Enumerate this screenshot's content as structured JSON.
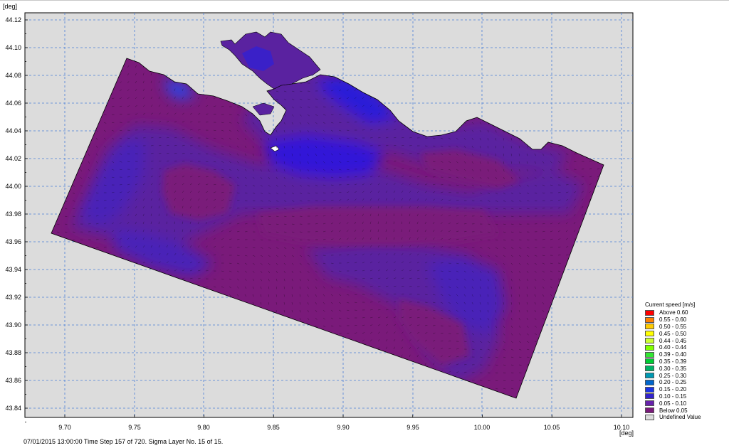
{
  "map": {
    "y_unit_label": "[deg]",
    "x_unit_label": "[deg]",
    "y_ticks": [
      "44.12",
      "44.10",
      "44.08",
      "44.06",
      "44.04",
      "44.02",
      "44.00",
      "43.98",
      "43.96",
      "43.94",
      "43.92",
      "43.90",
      "43.88",
      "43.86",
      "43.84"
    ],
    "x_ticks": [
      "9.70",
      "9.75",
      "9.80",
      "9.85",
      "9.90",
      "9.95",
      "10.00",
      "10.05",
      "10.10"
    ],
    "grid": true,
    "colors": {
      "background": "#dcdcdc",
      "land": "#dcdcdc",
      "grid_line": "#4a7fd8",
      "dominant_field": "#7a1a7a"
    }
  },
  "legend": {
    "title": "Current speed [m/s]",
    "items": [
      {
        "label": "Above 0.60",
        "color": "#ff0000"
      },
      {
        "label": "0.55 - 0.60",
        "color": "#ff7f00"
      },
      {
        "label": "0.50 - 0.55",
        "color": "#ffcc00"
      },
      {
        "label": "0.45 - 0.50",
        "color": "#ffff00"
      },
      {
        "label": "0.44 - 0.45",
        "color": "#ccff33"
      },
      {
        "label": "0.40 - 0.44",
        "color": "#80ff00"
      },
      {
        "label": "0.39 - 0.40",
        "color": "#33e633"
      },
      {
        "label": "0.35 - 0.39",
        "color": "#00cc33"
      },
      {
        "label": "0.30 - 0.35",
        "color": "#00b366"
      },
      {
        "label": "0.25 - 0.30",
        "color": "#0099b3"
      },
      {
        "label": "0.20 - 0.25",
        "color": "#0066cc"
      },
      {
        "label": "0.15 - 0.20",
        "color": "#1a33e6"
      },
      {
        "label": "0.10 - 0.15",
        "color": "#3322cc"
      },
      {
        "label": "0.05 - 0.10",
        "color": "#6622aa"
      },
      {
        "label": "Below 0.05",
        "color": "#7a1a7a"
      },
      {
        "label": "Undefined Value",
        "color": "#dcdcdc"
      }
    ]
  },
  "status_bar": {
    "text": "07/01/2015 13:00:00  Time Step 157 of 720. Sigma Layer No. 15 of 15."
  }
}
